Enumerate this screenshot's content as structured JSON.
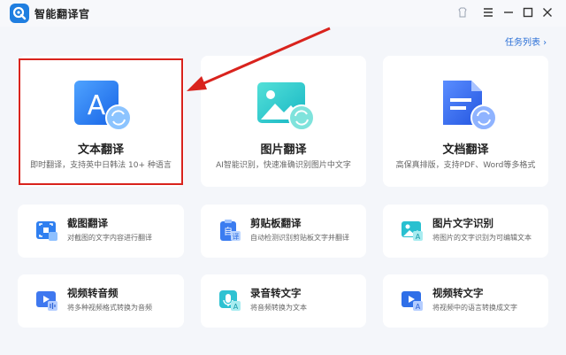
{
  "app": {
    "title": "智能翻译官"
  },
  "header": {
    "task_list": "任务列表 ›"
  },
  "big_cards": [
    {
      "title": "文本翻译",
      "desc": "即时翻译，支持英中日韩法 10+ 种语言",
      "icon": "text-translate-icon"
    },
    {
      "title": "图片翻译",
      "desc": "AI智能识别，快速准确识别图片中文字",
      "icon": "image-translate-icon"
    },
    {
      "title": "文档翻译",
      "desc": "高保真排版，支持PDF、Word等多格式",
      "icon": "document-translate-icon"
    }
  ],
  "small_cards": [
    {
      "title": "截图翻译",
      "desc": "对截图的文字内容进行翻译",
      "icon": "screenshot-translate-icon"
    },
    {
      "title": "剪贴板翻译",
      "desc": "自动检测识别剪贴板文字并翻译",
      "icon": "clipboard-translate-icon"
    },
    {
      "title": "图片文字识别",
      "desc": "将图片的文字识别为可编辑文本",
      "icon": "image-ocr-icon"
    },
    {
      "title": "视频转音频",
      "desc": "将多种视频格式转换为音频",
      "icon": "video-to-audio-icon"
    },
    {
      "title": "录音转文字",
      "desc": "将音频转换为文本",
      "icon": "audio-to-text-icon"
    },
    {
      "title": "视频转文字",
      "desc": "将视频中的语言转换成文字",
      "icon": "video-to-text-icon"
    }
  ],
  "colors": {
    "accent": "#2a6fd6",
    "highlight": "#d9231d",
    "background": "#f4f6fa"
  }
}
